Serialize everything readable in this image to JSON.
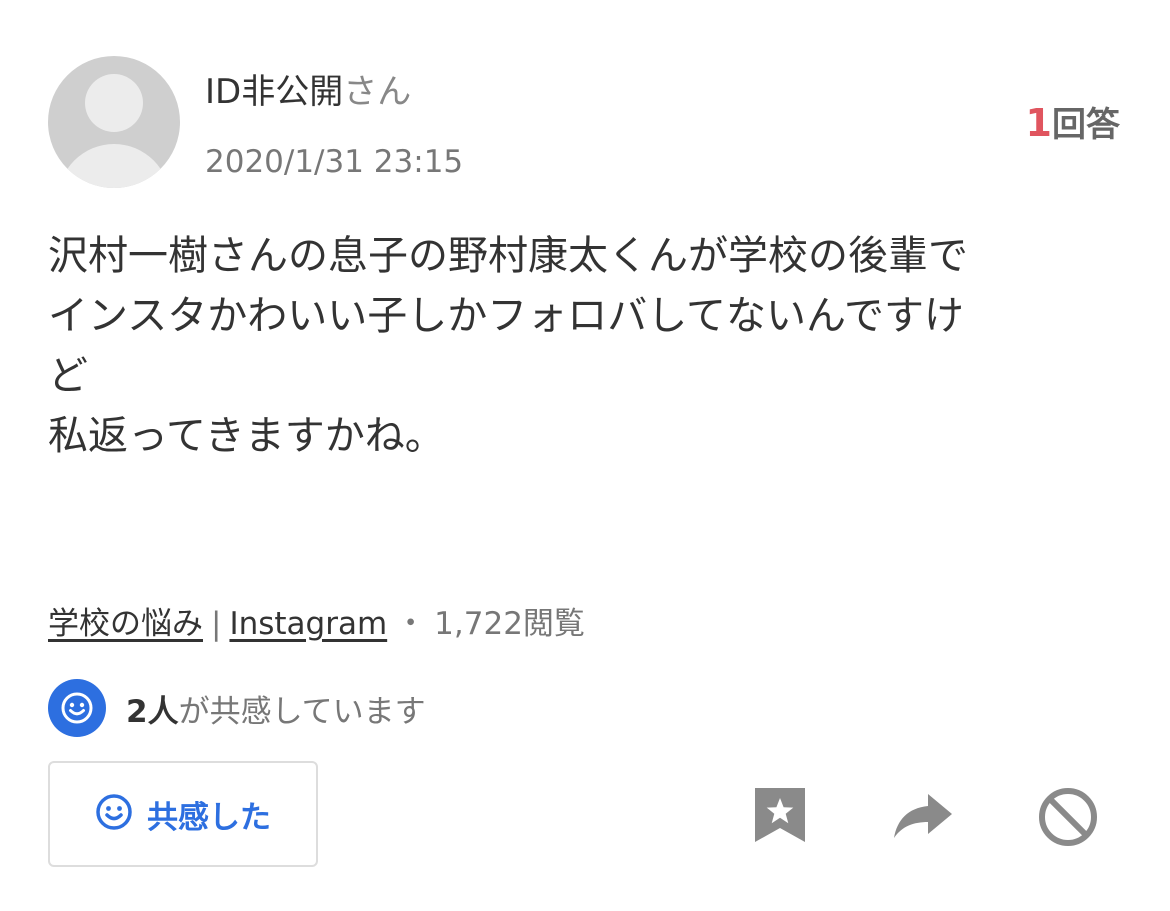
{
  "post": {
    "user_name": "ID非公開",
    "user_suffix": "さん",
    "timestamp": "2020/1/31 23:15",
    "answer_count": "1",
    "answer_label": "回答",
    "question_lines": [
      "沢村一樹さんの息子の野村康太くんが学校の後輩で",
      "インスタかわいい子しかフォロバしてないんですけ",
      "ど",
      "私返ってきますかね。"
    ]
  },
  "meta": {
    "category": "学校の悩み",
    "separator": "|",
    "tag": "Instagram",
    "dot": "・",
    "views": "1,722閲覧"
  },
  "empathy": {
    "count": "2人",
    "text": "が共感しています",
    "button_label": "共感した"
  },
  "icons": {
    "avatar": "default-user-avatar",
    "empathy_badge": "smiley-icon",
    "bookmark": "bookmark-star-icon",
    "share": "share-arrow-icon",
    "block": "block-icon"
  },
  "colors": {
    "accent_blue": "#2d6fe0",
    "answer_red": "#e0555f",
    "icon_gray": "#8a8a8a"
  }
}
